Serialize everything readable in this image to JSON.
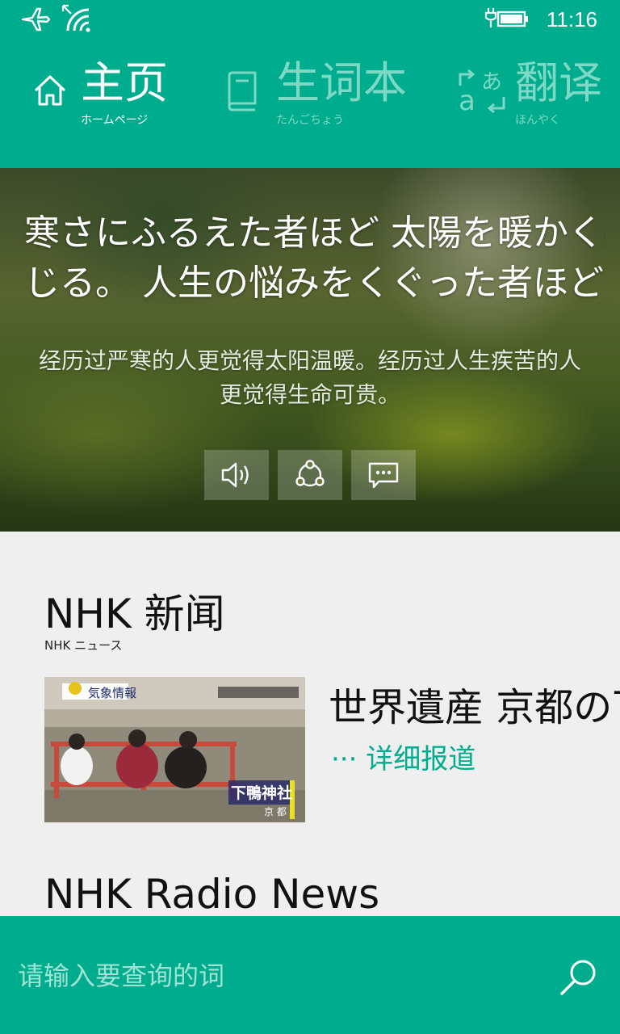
{
  "status": {
    "time": "11:16"
  },
  "nav": {
    "items": [
      {
        "label": "主页",
        "sub": "ホームページ"
      },
      {
        "label": "生词本",
        "sub": "たんごちょう"
      },
      {
        "label": "翻译",
        "sub": "ほんやく"
      }
    ]
  },
  "hero": {
    "japanese_line1": "寒さにふるえた者ほど 太陽を暖かく感",
    "japanese_line2": "じる。 人生の悩みをくぐった者ほど 生",
    "chinese": "经历过严寒的人更觉得太阳温暖。经历过人生疾苦的人更觉得生命可贵。"
  },
  "news": {
    "title": "NHK 新闻",
    "sub": "NHK ニュース",
    "item": {
      "headline": "世界遺産 京都の下",
      "more": "··· 详细报道",
      "thumb_caption1": "気象情報",
      "thumb_caption2": "下鴨神社",
      "thumb_caption3": "京 都"
    }
  },
  "radio": {
    "title": "NHK Radio News"
  },
  "search": {
    "placeholder": "请输入要查询的词"
  },
  "colors": {
    "accent": "#00ac8e",
    "inactive_nav": "#7dd9c6"
  }
}
